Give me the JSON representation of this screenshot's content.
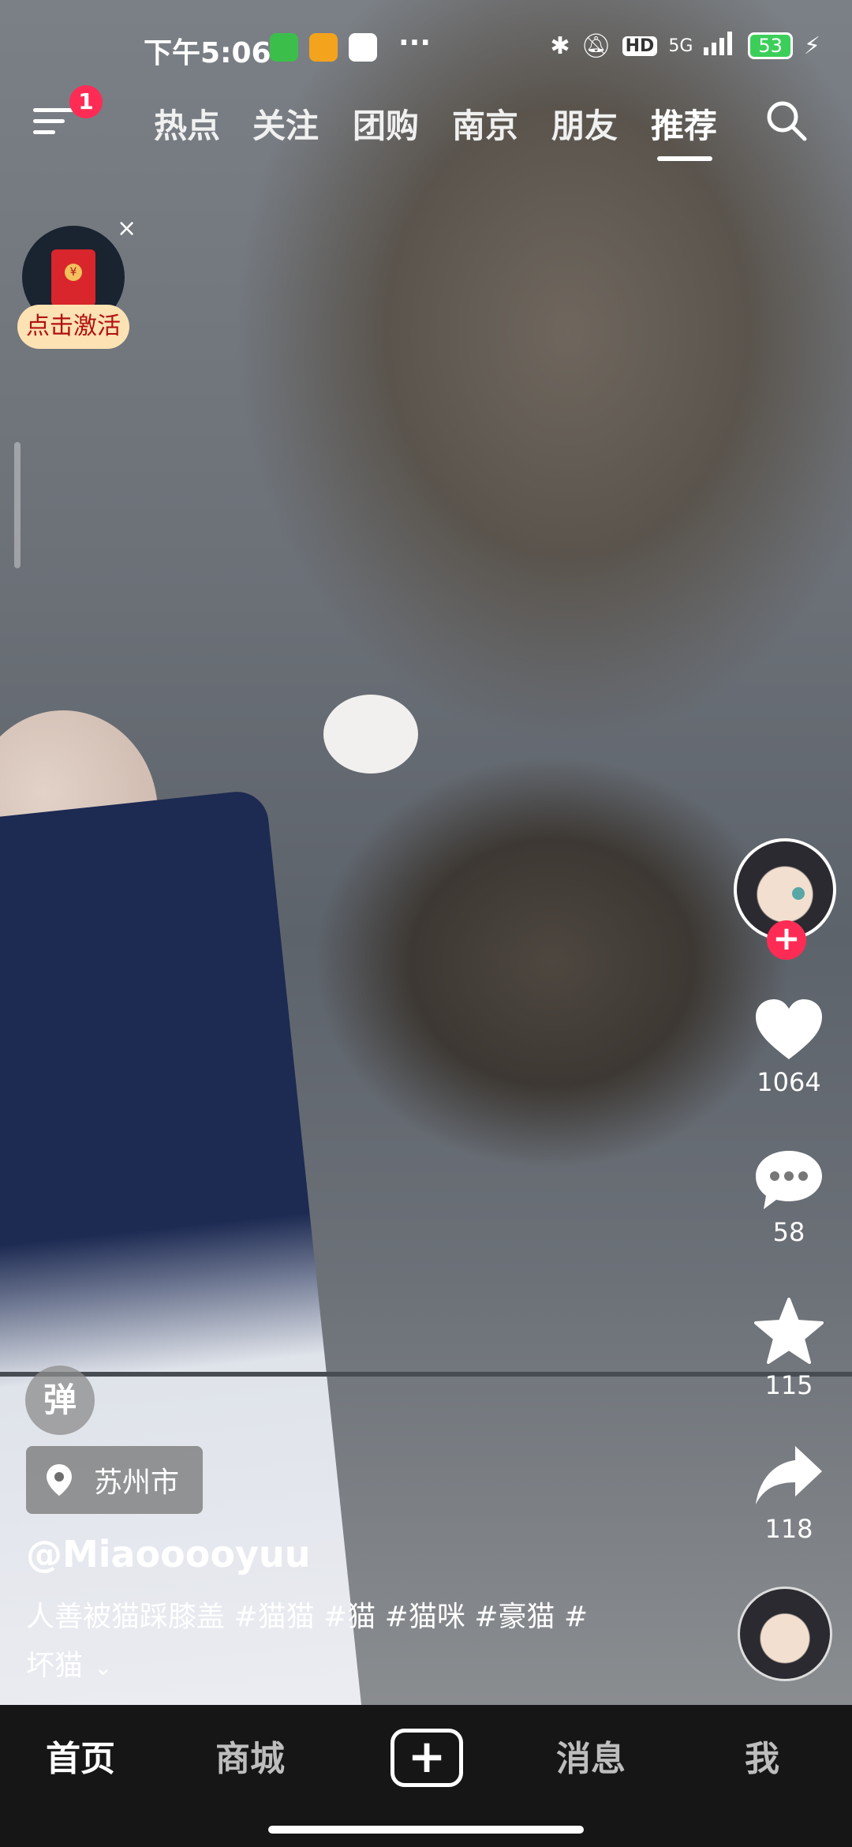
{
  "status_bar": {
    "time": "下午5:06",
    "network": "5G",
    "hd_label": "HD",
    "battery": "53",
    "more": "···"
  },
  "top_nav": {
    "menu_badge": "1",
    "tabs": [
      {
        "label": "热点"
      },
      {
        "label": "关注"
      },
      {
        "label": "团购"
      },
      {
        "label": "南京"
      },
      {
        "label": "朋友"
      },
      {
        "label": "推荐",
        "active": true
      }
    ]
  },
  "promo": {
    "label": "点击激活",
    "close": "×",
    "coin": "¥"
  },
  "actions": {
    "likes": "1064",
    "comments": "58",
    "favorites": "115",
    "shares": "118",
    "follow_plus": "+"
  },
  "video_info": {
    "danmu_label": "弹",
    "location": "苏州市",
    "username": "@Miaooooyuu",
    "caption_line1": "人善被猫踩膝盖 #猫猫 #猫 #猫咪 #豪猫 #",
    "caption_line2": "坏猫",
    "expand": "⌄"
  },
  "bottom_nav": {
    "home": "首页",
    "mall": "商城",
    "plus": "+",
    "messages": "消息",
    "me": "我"
  },
  "colors": {
    "accent": "#fe2c55",
    "battery": "#3bcf5a",
    "promo_bg": "#fde2b3"
  }
}
